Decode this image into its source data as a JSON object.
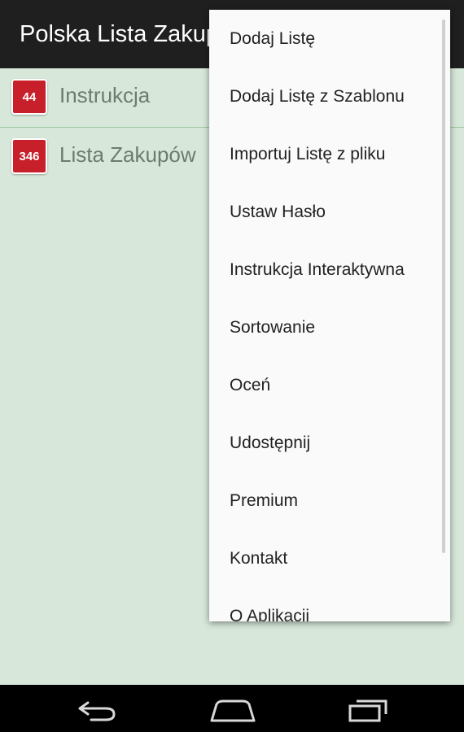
{
  "actionbar": {
    "title": "Polska Lista Zakupów"
  },
  "lists": [
    {
      "count": "44",
      "label": "Instrukcja"
    },
    {
      "count": "346",
      "label": "Lista Zakupów"
    }
  ],
  "menu": {
    "items": [
      {
        "label": "Dodaj Listę"
      },
      {
        "label": "Dodaj Listę z Szablonu"
      },
      {
        "label": "Importuj Listę z pliku"
      },
      {
        "label": "Ustaw Hasło"
      },
      {
        "label": "Instrukcja Interaktywna"
      },
      {
        "label": "Sortowanie"
      },
      {
        "label": "Oceń"
      },
      {
        "label": "Udostępnij"
      },
      {
        "label": "Premium"
      },
      {
        "label": "Kontakt"
      },
      {
        "label": "O Aplikacji"
      }
    ]
  },
  "navbar": {
    "icons": [
      "back-icon",
      "home-icon",
      "recent-apps-icon"
    ]
  },
  "colors": {
    "actionbar": "#1f1f1f",
    "background": "#d7e8da",
    "badge": "#c8202a",
    "divider": "#9cc59f",
    "menu": "#fafafa"
  }
}
